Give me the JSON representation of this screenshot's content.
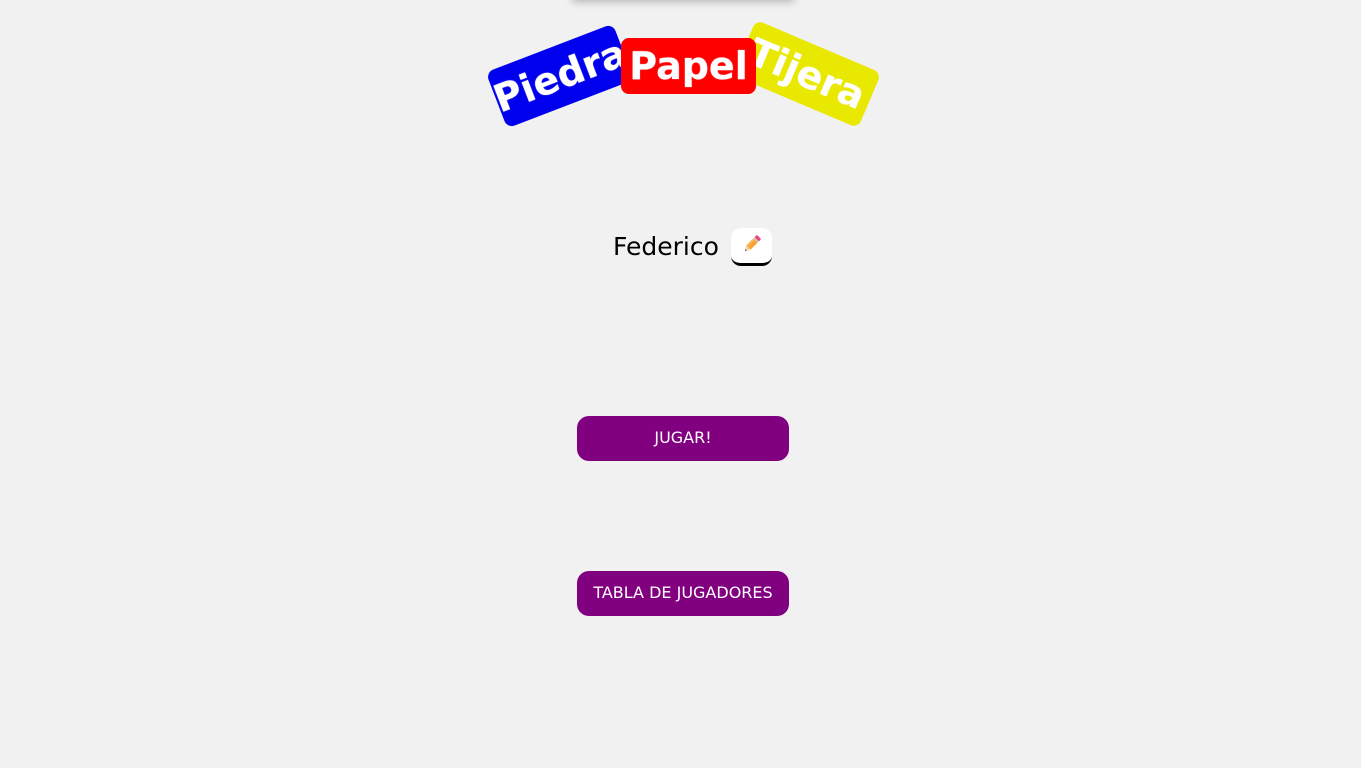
{
  "logo": {
    "word1": "Piedra",
    "word2": "Papel",
    "word3": "Tijera",
    "colors": {
      "piedra": "#0000ee",
      "papel": "#ff0000",
      "tijera": "#e8e800"
    }
  },
  "player": {
    "name": "Federico",
    "edit_icon": "pencil-icon"
  },
  "buttons": {
    "play_label": "JUGAR!",
    "leaderboard_label": "TABLA DE JUGADORES"
  },
  "theme": {
    "background": "#f1f1f1",
    "button_color": "#800080"
  }
}
